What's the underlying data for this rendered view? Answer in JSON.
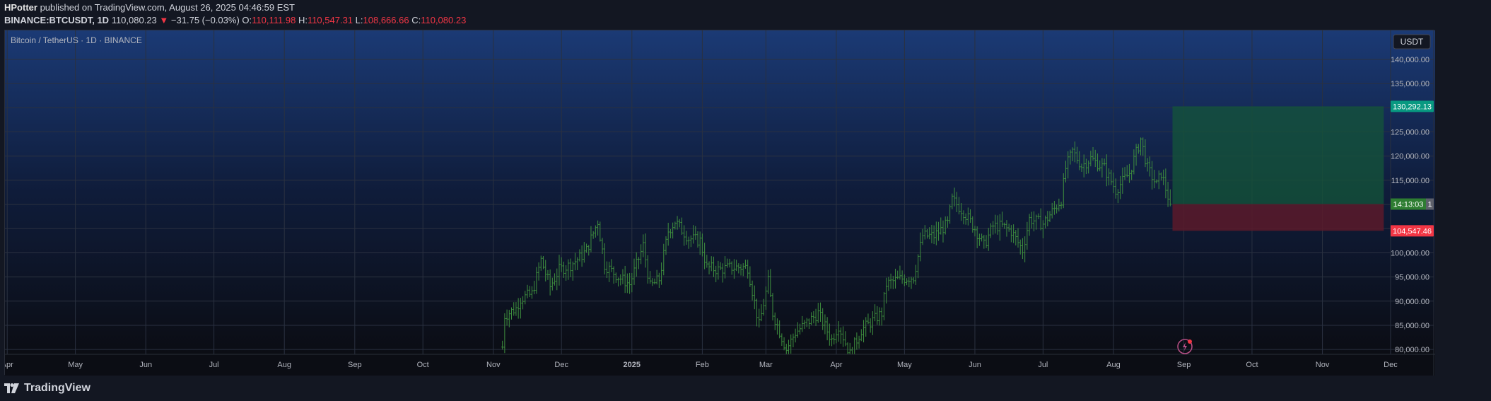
{
  "header": {
    "author": "HPotter",
    "published_text": "published on TradingView.com, August 26, 2025 04:46:59 EST",
    "symbol": "BINANCE:BTCUSDT, 1D",
    "last_price": "110,080.23",
    "change_arrow": "▼",
    "change": "−31.75 (−0.03%)",
    "open_label": "O:",
    "open": "110,111.98",
    "high_label": "H:",
    "high": "110,547.31",
    "low_label": "L:",
    "low": "108,666.66",
    "close_label": "C:",
    "close": "110,080.23"
  },
  "footer": {
    "brand": "TradingView"
  },
  "colors": {
    "background": "#131722",
    "bar": "#3e8e3e",
    "profit_zone": "#14553a",
    "loss_zone": "#5a1a2a",
    "profit_badge": "#089981",
    "loss_badge": "#f23645",
    "grid": "#2a3140",
    "axis_text": "#b2b5be",
    "plot_bg_top": "#1b3a75",
    "plot_bg_bottom": "#0b0d14"
  },
  "chart_data": {
    "type": "ohlc",
    "title": "Bitcoin / TetherUS · 1D · BINANCE",
    "currency_button": "USDT",
    "ylim": [
      79000,
      146000
    ],
    "y_ticks": [
      80000,
      85000,
      90000,
      95000,
      100000,
      105000,
      110000,
      115000,
      120000,
      125000,
      130000,
      135000,
      140000
    ],
    "y_tick_labels": [
      "80,000.00",
      "85,000.00",
      "90,000.00",
      "95,000.00",
      "100,000.00",
      "105,000.00",
      "110,000.00",
      "115,000.00",
      "120,000.00",
      "125,000.00",
      "130,000.00",
      "135,000.00",
      "140,000.00"
    ],
    "x_start": "2024-03-31",
    "x_end": "2025-12-20",
    "x_ticks": [
      {
        "date": "2024-04-01",
        "label": "Apr"
      },
      {
        "date": "2024-05-01",
        "label": "May"
      },
      {
        "date": "2024-06-01",
        "label": "Jun"
      },
      {
        "date": "2024-07-01",
        "label": "Jul"
      },
      {
        "date": "2024-08-01",
        "label": "Aug"
      },
      {
        "date": "2024-09-01",
        "label": "Sep"
      },
      {
        "date": "2024-10-01",
        "label": "Oct"
      },
      {
        "date": "2024-11-01",
        "label": "Nov"
      },
      {
        "date": "2024-12-01",
        "label": "Dec"
      },
      {
        "date": "2025-01-01",
        "label": "2025"
      },
      {
        "date": "2025-02-01",
        "label": "Feb"
      },
      {
        "date": "2025-03-01",
        "label": "Mar"
      },
      {
        "date": "2025-04-01",
        "label": "Apr"
      },
      {
        "date": "2025-05-01",
        "label": "May"
      },
      {
        "date": "2025-06-01",
        "label": "Jun"
      },
      {
        "date": "2025-07-01",
        "label": "Jul"
      },
      {
        "date": "2025-08-01",
        "label": "Aug"
      },
      {
        "date": "2025-09-01",
        "label": "Sep"
      },
      {
        "date": "2025-10-01",
        "label": "Oct"
      },
      {
        "date": "2025-11-01",
        "label": "Nov"
      },
      {
        "date": "2025-12-01",
        "label": "Dec"
      }
    ],
    "bars_start": "2024-11-05",
    "bars_end": "2025-08-26",
    "close_anchors": [
      [
        "2024-11-05",
        80500
      ],
      [
        "2024-11-06",
        87000
      ],
      [
        "2024-11-11",
        88500
      ],
      [
        "2024-11-13",
        90500
      ],
      [
        "2024-11-18",
        91500
      ],
      [
        "2024-11-22",
        98500
      ],
      [
        "2024-11-26",
        93000
      ],
      [
        "2024-11-30",
        96500
      ],
      [
        "2024-12-05",
        97500
      ],
      [
        "2024-12-09",
        99000
      ],
      [
        "2024-12-12",
        100500
      ],
      [
        "2024-12-17",
        106500
      ],
      [
        "2024-12-20",
        97500
      ],
      [
        "2024-12-26",
        95000
      ],
      [
        "2024-12-31",
        93500
      ],
      [
        "2025-01-06",
        101500
      ],
      [
        "2025-01-09",
        93000
      ],
      [
        "2025-01-13",
        94500
      ],
      [
        "2025-01-17",
        104500
      ],
      [
        "2025-01-20",
        106500
      ],
      [
        "2025-01-26",
        103000
      ],
      [
        "2025-01-31",
        102500
      ],
      [
        "2025-02-03",
        97000
      ],
      [
        "2025-02-08",
        96500
      ],
      [
        "2025-02-14",
        97000
      ],
      [
        "2025-02-21",
        97000
      ],
      [
        "2025-02-26",
        85000
      ],
      [
        "2025-03-02",
        94000
      ],
      [
        "2025-03-04",
        87500
      ],
      [
        "2025-03-10",
        80000
      ],
      [
        "2025-03-14",
        83500
      ],
      [
        "2025-03-24",
        87500
      ],
      [
        "2025-03-30",
        82000
      ],
      [
        "2025-04-02",
        85000
      ],
      [
        "2025-04-07",
        79000
      ],
      [
        "2025-04-12",
        84000
      ],
      [
        "2025-04-21",
        87500
      ],
      [
        "2025-04-23",
        93500
      ],
      [
        "2025-04-28",
        94500
      ],
      [
        "2025-05-05",
        95000
      ],
      [
        "2025-05-09",
        103500
      ],
      [
        "2025-05-14",
        103500
      ],
      [
        "2025-05-20",
        106000
      ],
      [
        "2025-05-22",
        111000
      ],
      [
        "2025-05-27",
        108500
      ],
      [
        "2025-06-01",
        105000
      ],
      [
        "2025-06-05",
        101500
      ],
      [
        "2025-06-09",
        105500
      ],
      [
        "2025-06-13",
        105500
      ],
      [
        "2025-06-17",
        104500
      ],
      [
        "2025-06-22",
        100500
      ],
      [
        "2025-06-25",
        107000
      ],
      [
        "2025-07-01",
        106000
      ],
      [
        "2025-07-05",
        108500
      ],
      [
        "2025-07-09",
        111000
      ],
      [
        "2025-07-11",
        117500
      ],
      [
        "2025-07-14",
        121000
      ],
      [
        "2025-07-18",
        118000
      ],
      [
        "2025-07-22",
        119500
      ],
      [
        "2025-07-28",
        117500
      ],
      [
        "2025-08-02",
        113000
      ],
      [
        "2025-08-08",
        116500
      ],
      [
        "2025-08-13",
        123500
      ],
      [
        "2025-08-16",
        117500
      ],
      [
        "2025-08-20",
        114000
      ],
      [
        "2025-08-22",
        116500
      ],
      [
        "2025-08-26",
        110080
      ]
    ],
    "position": {
      "start_date": "2025-08-27",
      "end_date": "2025-11-28",
      "entry_price": 110080,
      "entry_label": "14:13:03",
      "entry_extra": "1",
      "target_price": 130292.13,
      "target_label": "130,292.13",
      "stop_price": 104547.46,
      "stop_label": "104,547.46"
    }
  }
}
